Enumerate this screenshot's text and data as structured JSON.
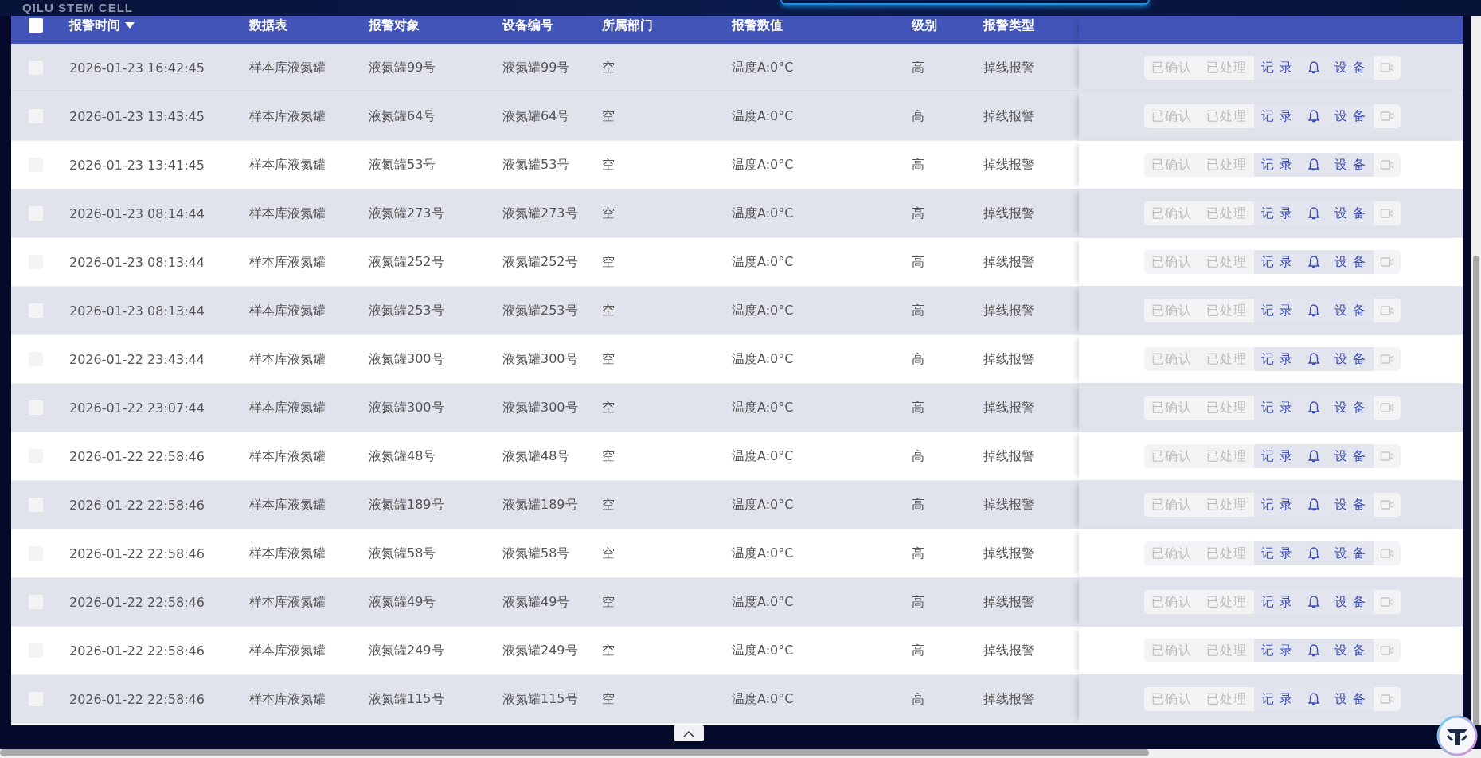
{
  "brand": "QILU STEM CELL",
  "table": {
    "header_checked": false,
    "columns": [
      {
        "label": "报警时间",
        "sorted": true
      },
      {
        "label": "数据表",
        "sorted": false
      },
      {
        "label": "报警对象",
        "sorted": false
      },
      {
        "label": "设备编号",
        "sorted": false
      },
      {
        "label": "所属部门",
        "sorted": false
      },
      {
        "label": "报警数值",
        "sorted": false
      },
      {
        "label": "级别",
        "sorted": false
      },
      {
        "label": "报警类型",
        "sorted": false
      }
    ],
    "rows": [
      {
        "highlighted": true,
        "checked": false,
        "cells": [
          "2026-01-23 16:42:45",
          "样本库液氮罐",
          "液氮罐99号",
          "液氮罐99号",
          "空",
          "温度A:0°C",
          "高",
          "掉线报警"
        ],
        "actions": [
          {
            "kind": "text",
            "label": "已确认",
            "disabled": true
          },
          {
            "kind": "text",
            "label": "已处理",
            "disabled": true
          },
          {
            "kind": "text",
            "label": "记 录",
            "disabled": false
          },
          {
            "kind": "bell",
            "disabled": false
          },
          {
            "kind": "text",
            "label": "设 备",
            "disabled": false
          },
          {
            "kind": "camera",
            "disabled": true
          }
        ]
      },
      {
        "highlighted": false,
        "checked": false,
        "cells": [
          "2026-01-23 13:43:45",
          "样本库液氮罐",
          "液氮罐64号",
          "液氮罐64号",
          "空",
          "温度A:0°C",
          "高",
          "掉线报警"
        ],
        "actions": [
          {
            "kind": "text",
            "label": "已确认",
            "disabled": true
          },
          {
            "kind": "text",
            "label": "已处理",
            "disabled": true
          },
          {
            "kind": "text",
            "label": "记 录",
            "disabled": false
          },
          {
            "kind": "bell",
            "disabled": false
          },
          {
            "kind": "text",
            "label": "设 备",
            "disabled": false
          },
          {
            "kind": "camera",
            "disabled": true
          }
        ]
      },
      {
        "highlighted": false,
        "checked": false,
        "cells": [
          "2026-01-23 13:41:45",
          "样本库液氮罐",
          "液氮罐53号",
          "液氮罐53号",
          "空",
          "温度A:0°C",
          "高",
          "掉线报警"
        ],
        "actions": [
          {
            "kind": "text",
            "label": "已确认",
            "disabled": true
          },
          {
            "kind": "text",
            "label": "已处理",
            "disabled": true
          },
          {
            "kind": "text",
            "label": "记 录",
            "disabled": false
          },
          {
            "kind": "bell",
            "disabled": false
          },
          {
            "kind": "text",
            "label": "设 备",
            "disabled": false
          },
          {
            "kind": "camera",
            "disabled": true
          }
        ]
      },
      {
        "highlighted": false,
        "checked": false,
        "cells": [
          "2026-01-23 08:14:44",
          "样本库液氮罐",
          "液氮罐273号",
          "液氮罐273号",
          "空",
          "温度A:0°C",
          "高",
          "掉线报警"
        ],
        "actions": [
          {
            "kind": "text",
            "label": "已确认",
            "disabled": true
          },
          {
            "kind": "text",
            "label": "已处理",
            "disabled": true
          },
          {
            "kind": "text",
            "label": "记 录",
            "disabled": false
          },
          {
            "kind": "bell",
            "disabled": false
          },
          {
            "kind": "text",
            "label": "设 备",
            "disabled": false
          },
          {
            "kind": "camera",
            "disabled": true
          }
        ]
      },
      {
        "highlighted": false,
        "checked": false,
        "cells": [
          "2026-01-23 08:13:44",
          "样本库液氮罐",
          "液氮罐252号",
          "液氮罐252号",
          "空",
          "温度A:0°C",
          "高",
          "掉线报警"
        ],
        "actions": [
          {
            "kind": "text",
            "label": "已确认",
            "disabled": true
          },
          {
            "kind": "text",
            "label": "已处理",
            "disabled": true
          },
          {
            "kind": "text",
            "label": "记 录",
            "disabled": false
          },
          {
            "kind": "bell",
            "disabled": false
          },
          {
            "kind": "text",
            "label": "设 备",
            "disabled": false
          },
          {
            "kind": "camera",
            "disabled": true
          }
        ]
      },
      {
        "highlighted": false,
        "checked": false,
        "cells": [
          "2026-01-23 08:13:44",
          "样本库液氮罐",
          "液氮罐253号",
          "液氮罐253号",
          "空",
          "温度A:0°C",
          "高",
          "掉线报警"
        ],
        "actions": [
          {
            "kind": "text",
            "label": "已确认",
            "disabled": true
          },
          {
            "kind": "text",
            "label": "已处理",
            "disabled": true
          },
          {
            "kind": "text",
            "label": "记 录",
            "disabled": false
          },
          {
            "kind": "bell",
            "disabled": false
          },
          {
            "kind": "text",
            "label": "设 备",
            "disabled": false
          },
          {
            "kind": "camera",
            "disabled": true
          }
        ]
      },
      {
        "highlighted": false,
        "checked": false,
        "cells": [
          "2026-01-22 23:43:44",
          "样本库液氮罐",
          "液氮罐300号",
          "液氮罐300号",
          "空",
          "温度A:0°C",
          "高",
          "掉线报警"
        ],
        "actions": [
          {
            "kind": "text",
            "label": "已确认",
            "disabled": true
          },
          {
            "kind": "text",
            "label": "已处理",
            "disabled": true
          },
          {
            "kind": "text",
            "label": "记 录",
            "disabled": false
          },
          {
            "kind": "bell",
            "disabled": false
          },
          {
            "kind": "text",
            "label": "设 备",
            "disabled": false
          },
          {
            "kind": "camera",
            "disabled": true
          }
        ]
      },
      {
        "highlighted": false,
        "checked": false,
        "cells": [
          "2026-01-22 23:07:44",
          "样本库液氮罐",
          "液氮罐300号",
          "液氮罐300号",
          "空",
          "温度A:0°C",
          "高",
          "掉线报警"
        ],
        "actions": [
          {
            "kind": "text",
            "label": "已确认",
            "disabled": true
          },
          {
            "kind": "text",
            "label": "已处理",
            "disabled": true
          },
          {
            "kind": "text",
            "label": "记 录",
            "disabled": false
          },
          {
            "kind": "bell",
            "disabled": false
          },
          {
            "kind": "text",
            "label": "设 备",
            "disabled": false
          },
          {
            "kind": "camera",
            "disabled": true
          }
        ]
      },
      {
        "highlighted": false,
        "checked": false,
        "cells": [
          "2026-01-22 22:58:46",
          "样本库液氮罐",
          "液氮罐48号",
          "液氮罐48号",
          "空",
          "温度A:0°C",
          "高",
          "掉线报警"
        ],
        "actions": [
          {
            "kind": "text",
            "label": "已确认",
            "disabled": true
          },
          {
            "kind": "text",
            "label": "已处理",
            "disabled": true
          },
          {
            "kind": "text",
            "label": "记 录",
            "disabled": false
          },
          {
            "kind": "bell",
            "disabled": false
          },
          {
            "kind": "text",
            "label": "设 备",
            "disabled": false
          },
          {
            "kind": "camera",
            "disabled": true
          }
        ]
      },
      {
        "highlighted": false,
        "checked": false,
        "cells": [
          "2026-01-22 22:58:46",
          "样本库液氮罐",
          "液氮罐189号",
          "液氮罐189号",
          "空",
          "温度A:0°C",
          "高",
          "掉线报警"
        ],
        "actions": [
          {
            "kind": "text",
            "label": "已确认",
            "disabled": true
          },
          {
            "kind": "text",
            "label": "已处理",
            "disabled": true
          },
          {
            "kind": "text",
            "label": "记 录",
            "disabled": false
          },
          {
            "kind": "bell",
            "disabled": false
          },
          {
            "kind": "text",
            "label": "设 备",
            "disabled": false
          },
          {
            "kind": "camera",
            "disabled": true
          }
        ]
      },
      {
        "highlighted": false,
        "checked": false,
        "cells": [
          "2026-01-22 22:58:46",
          "样本库液氮罐",
          "液氮罐58号",
          "液氮罐58号",
          "空",
          "温度A:0°C",
          "高",
          "掉线报警"
        ],
        "actions": [
          {
            "kind": "text",
            "label": "已确认",
            "disabled": true
          },
          {
            "kind": "text",
            "label": "已处理",
            "disabled": true
          },
          {
            "kind": "text",
            "label": "记 录",
            "disabled": false
          },
          {
            "kind": "bell",
            "disabled": false
          },
          {
            "kind": "text",
            "label": "设 备",
            "disabled": false
          },
          {
            "kind": "camera",
            "disabled": true
          }
        ]
      },
      {
        "highlighted": false,
        "checked": false,
        "cells": [
          "2026-01-22 22:58:46",
          "样本库液氮罐",
          "液氮罐49号",
          "液氮罐49号",
          "空",
          "温度A:0°C",
          "高",
          "掉线报警"
        ],
        "actions": [
          {
            "kind": "text",
            "label": "已确认",
            "disabled": true
          },
          {
            "kind": "text",
            "label": "已处理",
            "disabled": true
          },
          {
            "kind": "text",
            "label": "记 录",
            "disabled": false
          },
          {
            "kind": "bell",
            "disabled": false
          },
          {
            "kind": "text",
            "label": "设 备",
            "disabled": false
          },
          {
            "kind": "camera",
            "disabled": true
          }
        ]
      },
      {
        "highlighted": false,
        "checked": false,
        "cells": [
          "2026-01-22 22:58:46",
          "样本库液氮罐",
          "液氮罐249号",
          "液氮罐249号",
          "空",
          "温度A:0°C",
          "高",
          "掉线报警"
        ],
        "actions": [
          {
            "kind": "text",
            "label": "已确认",
            "disabled": true
          },
          {
            "kind": "text",
            "label": "已处理",
            "disabled": true
          },
          {
            "kind": "text",
            "label": "记 录",
            "disabled": false
          },
          {
            "kind": "bell",
            "disabled": false
          },
          {
            "kind": "text",
            "label": "设 备",
            "disabled": false
          },
          {
            "kind": "camera",
            "disabled": true
          }
        ]
      },
      {
        "highlighted": false,
        "checked": false,
        "cells": [
          "2026-01-22 22:58:46",
          "样本库液氮罐",
          "液氮罐115号",
          "液氮罐115号",
          "空",
          "温度A:0°C",
          "高",
          "掉线报警"
        ],
        "actions": [
          {
            "kind": "text",
            "label": "已确认",
            "disabled": true
          },
          {
            "kind": "text",
            "label": "已处理",
            "disabled": true
          },
          {
            "kind": "text",
            "label": "记 录",
            "disabled": false
          },
          {
            "kind": "bell",
            "disabled": false
          },
          {
            "kind": "text",
            "label": "设 备",
            "disabled": false
          },
          {
            "kind": "camera",
            "disabled": true
          }
        ]
      }
    ]
  }
}
